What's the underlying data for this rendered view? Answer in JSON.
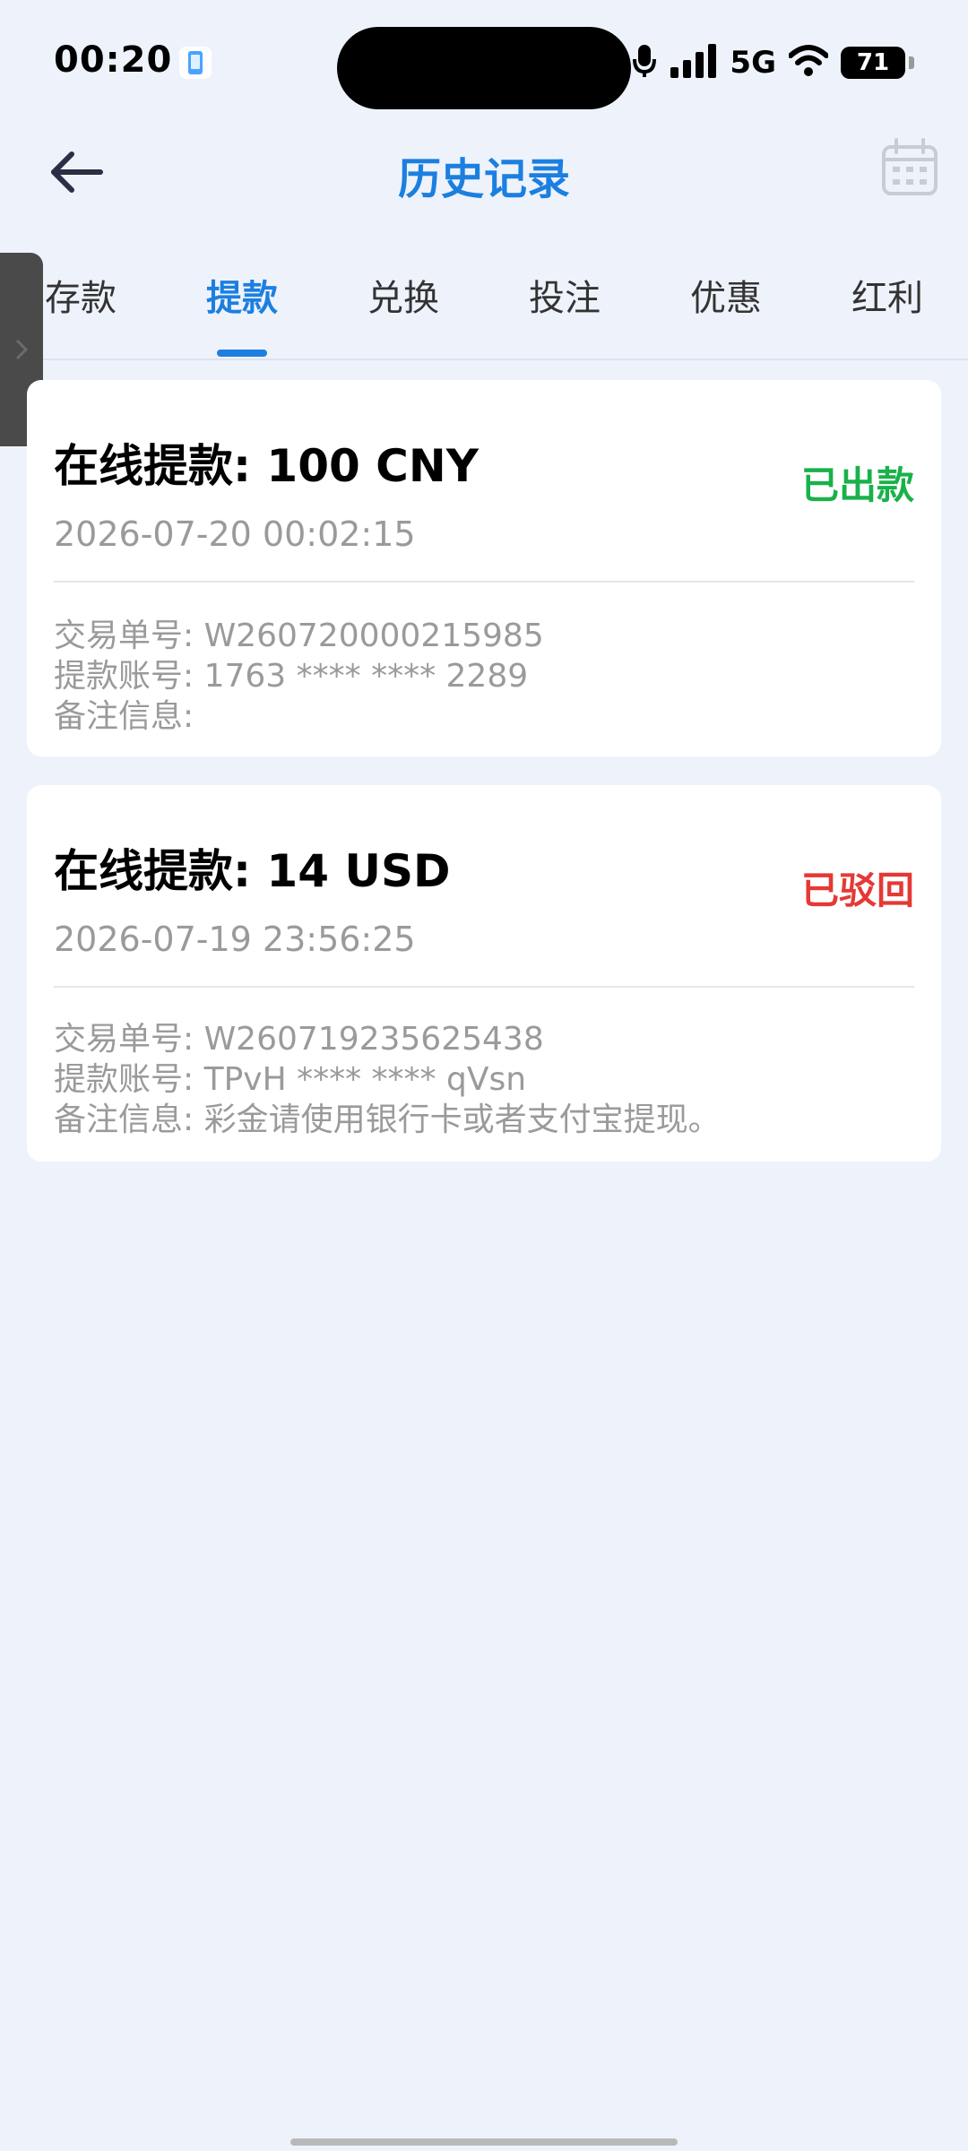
{
  "status_bar": {
    "time": "00:20",
    "network": "5G",
    "battery": "71"
  },
  "header": {
    "title": "历史记录",
    "back_icon": "arrow-left-icon",
    "calendar_icon": "calendar-icon"
  },
  "tabs": [
    {
      "label": "存款",
      "active": false
    },
    {
      "label": "提款",
      "active": true
    },
    {
      "label": "兑换",
      "active": false
    },
    {
      "label": "投注",
      "active": false
    },
    {
      "label": "优惠",
      "active": false
    },
    {
      "label": "红利",
      "active": false
    }
  ],
  "records": [
    {
      "title": "在线提款: 100 CNY",
      "status": "已出款",
      "status_color": "#19b14a",
      "datetime": "2026-07-20 00:02:15",
      "order_no": "交易单号: W260720000215985",
      "account": "提款账号: 1763 **** **** 2289",
      "remark": "备注信息:"
    },
    {
      "title": "在线提款: 14 USD",
      "status": "已驳回",
      "status_color": "#e53935",
      "datetime": "2026-07-19 23:56:25",
      "order_no": "交易单号: W260719235625438",
      "account": "提款账号: TPvH **** **** qVsn",
      "remark": "备注信息: 彩金请使用银行卡或者支付宝提现。"
    }
  ],
  "colors": {
    "accent": "#1c7fe0",
    "background": "#eef3fb",
    "muted_text": "#9a9a9a"
  }
}
